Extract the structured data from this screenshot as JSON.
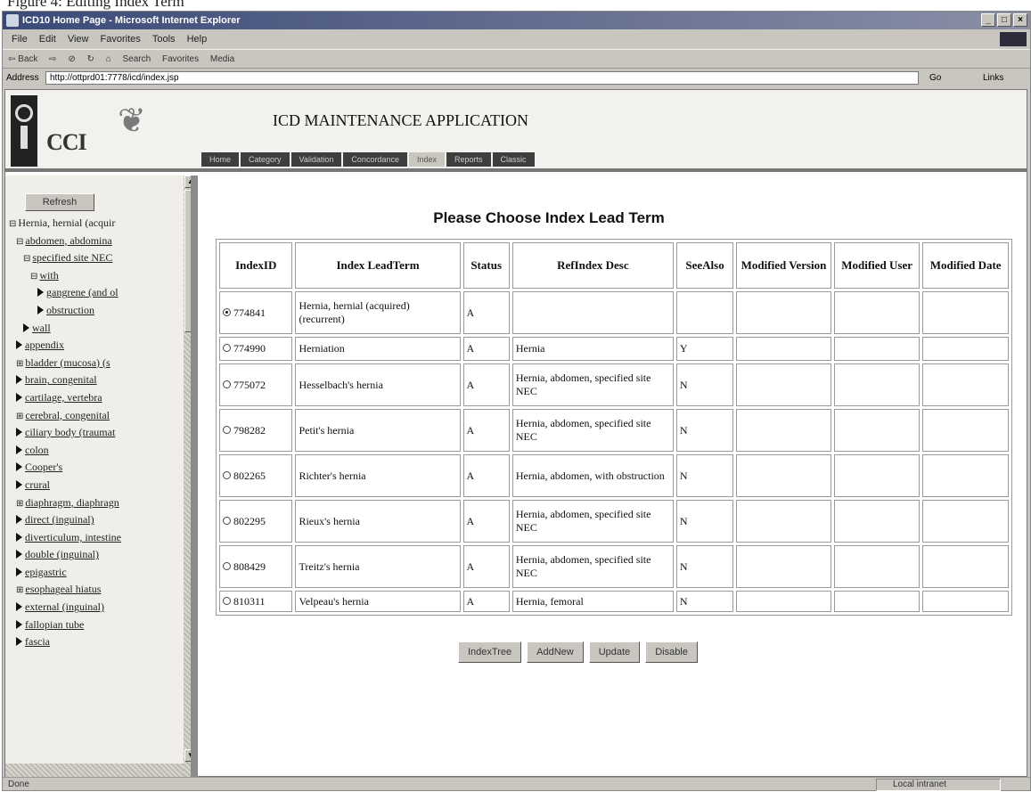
{
  "caption": "Figure 4: Editing Index Term",
  "window": {
    "title": "ICD10 Home Page - Microsoft Internet Explorer",
    "menu": [
      "File",
      "Edit",
      "View",
      "Favorites",
      "Tools",
      "Help"
    ],
    "toolbar": [
      "⇦ Back",
      "⇨",
      "⊘",
      "↻",
      "⌂",
      "Search",
      "Favorites",
      "Media"
    ],
    "address_label": "Address",
    "address": "http://ottprd01:7778/icd/index.jsp",
    "go": "Go",
    "links": "Links",
    "status_left": "Done",
    "status_zone": "Local intranet"
  },
  "app": {
    "logo_text": "CCI",
    "title": "ICD MAINTENANCE APPLICATION",
    "tabs": [
      "Home",
      "Category",
      "Validation",
      "Concordance",
      "Index",
      "Reports",
      "Classic"
    ]
  },
  "sidebar": {
    "refresh": "Refresh",
    "tree": [
      {
        "label": "Hernia, hernial (acquir",
        "marker": "⊟",
        "indent": 0,
        "link": false
      },
      {
        "label": "abdomen, abdomina",
        "marker": "⊟",
        "indent": 1,
        "link": true
      },
      {
        "label": "specified site NEC",
        "marker": "⊟",
        "indent": 2,
        "link": true
      },
      {
        "label": "with",
        "marker": "⊟",
        "indent": 3,
        "link": true
      },
      {
        "label": "gangrene (and ol",
        "marker": "arrow",
        "indent": 4,
        "link": true
      },
      {
        "label": "obstruction",
        "marker": "arrow",
        "indent": 4,
        "link": true
      },
      {
        "label": "wall",
        "marker": "arrow",
        "indent": 2,
        "link": true
      },
      {
        "label": "appendix",
        "marker": "arrow",
        "indent": 1,
        "link": true
      },
      {
        "label": "bladder (mucosa) (s",
        "marker": "⊞",
        "indent": 1,
        "link": true
      },
      {
        "label": "brain, congenital",
        "marker": "arrow",
        "indent": 1,
        "link": true
      },
      {
        "label": "cartilage, vertebra",
        "marker": "arrow",
        "indent": 1,
        "link": true
      },
      {
        "label": "cerebral, congenital",
        "marker": "⊞",
        "indent": 1,
        "link": true
      },
      {
        "label": "ciliary body (traumat",
        "marker": "arrow",
        "indent": 1,
        "link": true
      },
      {
        "label": "colon",
        "marker": "arrow",
        "indent": 1,
        "link": true
      },
      {
        "label": "Cooper's",
        "marker": "arrow",
        "indent": 1,
        "link": true
      },
      {
        "label": "crural",
        "marker": "arrow",
        "indent": 1,
        "link": true
      },
      {
        "label": "diaphragm, diaphragn",
        "marker": "⊞",
        "indent": 1,
        "link": true
      },
      {
        "label": "direct (inguinal)",
        "marker": "arrow",
        "indent": 1,
        "link": true
      },
      {
        "label": "diverticulum, intestine",
        "marker": "arrow",
        "indent": 1,
        "link": true
      },
      {
        "label": "double (inguinal)",
        "marker": "arrow",
        "indent": 1,
        "link": true
      },
      {
        "label": "epigastric",
        "marker": "arrow",
        "indent": 1,
        "link": true
      },
      {
        "label": "esophageal hiatus",
        "marker": "⊞",
        "indent": 1,
        "link": true
      },
      {
        "label": "external (inguinal)",
        "marker": "arrow",
        "indent": 1,
        "link": true
      },
      {
        "label": "fallopian tube",
        "marker": "arrow",
        "indent": 1,
        "link": true
      },
      {
        "label": "fascia",
        "marker": "arrow",
        "indent": 1,
        "link": true
      }
    ]
  },
  "main": {
    "heading": "Please Choose Index Lead Term",
    "columns": [
      "IndexID",
      "Index LeadTerm",
      "Status",
      "RefIndex Desc",
      "SeeAlso",
      "Modified Version",
      "Modified User",
      "Modified Date"
    ],
    "rows": [
      {
        "id": "774841",
        "term": "Hernia, hernial (acquired) (recurrent)",
        "status": "A",
        "ref": "",
        "see": "",
        "ver": "",
        "user": "",
        "date": "",
        "selected": true
      },
      {
        "id": "774990",
        "term": "Herniation",
        "status": "A",
        "ref": "Hernia",
        "see": "Y",
        "ver": "",
        "user": "",
        "date": "",
        "selected": false
      },
      {
        "id": "775072",
        "term": "Hesselbach's hernia",
        "status": "A",
        "ref": "Hernia, abdomen, specified site NEC",
        "see": "N",
        "ver": "",
        "user": "",
        "date": "",
        "selected": false
      },
      {
        "id": "798282",
        "term": "Petit's hernia",
        "status": "A",
        "ref": "Hernia, abdomen, specified site NEC",
        "see": "N",
        "ver": "",
        "user": "",
        "date": "",
        "selected": false
      },
      {
        "id": "802265",
        "term": "Richter's hernia",
        "status": "A",
        "ref": "Hernia, abdomen, with obstruction",
        "see": "N",
        "ver": "",
        "user": "",
        "date": "",
        "selected": false
      },
      {
        "id": "802295",
        "term": "Rieux's hernia",
        "status": "A",
        "ref": "Hernia, abdomen, specified site NEC",
        "see": "N",
        "ver": "",
        "user": "",
        "date": "",
        "selected": false
      },
      {
        "id": "808429",
        "term": "Treitz's hernia",
        "status": "A",
        "ref": "Hernia, abdomen, specified site NEC",
        "see": "N",
        "ver": "",
        "user": "",
        "date": "",
        "selected": false
      },
      {
        "id": "810311",
        "term": "Velpeau's hernia",
        "status": "A",
        "ref": "Hernia, femoral",
        "see": "N",
        "ver": "",
        "user": "",
        "date": "",
        "selected": false
      }
    ],
    "actions": [
      "IndexTree",
      "AddNew",
      "Update",
      "Disable"
    ]
  }
}
